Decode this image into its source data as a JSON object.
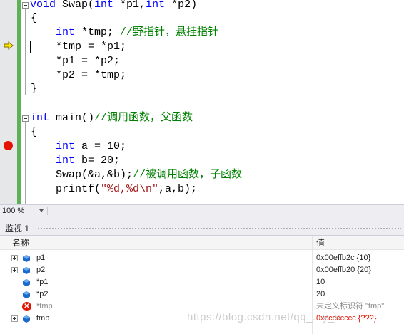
{
  "editor": {
    "lines": {
      "l1": {
        "kw1": "void",
        "rest1": " Swap(",
        "kw2": "int",
        "rest2": " *p1,",
        "kw3": "int",
        "rest3": " *p2)"
      },
      "l2": "{",
      "l3": {
        "kw": "int",
        "rest": " *tmp; ",
        "comment": "//野指针，悬挂指针"
      },
      "l4": "*tmp = *p1;",
      "l5": "*p1 = *p2;",
      "l6": "*p2 = *tmp;",
      "l7": "}",
      "l9": {
        "kw": "int",
        "rest": " main()",
        "comment": "//调用函数，父函数"
      },
      "l10": "{",
      "l11": {
        "kw": "int",
        "rest": " a = 10;"
      },
      "l12": {
        "kw": "int",
        "rest": " b= 20;"
      },
      "l13": {
        "rest": "Swap(&a,&b);",
        "comment": "//被调用函数，子函数"
      },
      "l14": {
        "pre": "printf(",
        "str": "\"%d,%d\\n\"",
        "post": ",a,b);"
      }
    }
  },
  "zoom": {
    "value": "100 %"
  },
  "watch": {
    "title": "监视 1",
    "col_name": "名称",
    "col_value": "值",
    "rows": [
      {
        "name": "p1",
        "value": "0x00effb2c {10}"
      },
      {
        "name": "p2",
        "value": "0x00effb20 {20}"
      },
      {
        "name": "*p1",
        "value": "10"
      },
      {
        "name": "*p2",
        "value": "20"
      },
      {
        "name": "*tmp",
        "value": "未定义标识符 \"tmp\""
      },
      {
        "name": "tmp",
        "value": "0xcccccccc {???}"
      }
    ]
  },
  "watermark": "https://blog.csdn.net/qq_...y_s",
  "colors": {
    "keyword": "#0000ff",
    "comment": "#008000",
    "string": "#a31515",
    "error": "#e51400",
    "change_bar": "#5fb157"
  }
}
